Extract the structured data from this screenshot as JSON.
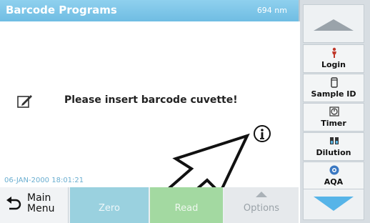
{
  "header": {
    "title": "Barcode Programs",
    "wavelength": "694 nm"
  },
  "main": {
    "message": "Please insert barcode cuvette!",
    "datetime": "06-JAN-2000  18:01:21"
  },
  "bottom": {
    "main_menu_line1": "Main",
    "main_menu_line2": "Menu",
    "zero": "Zero",
    "read": "Read",
    "options": "Options"
  },
  "sidebar": {
    "items": [
      {
        "label": "Login",
        "icon": "login-icon"
      },
      {
        "label": "Sample ID",
        "icon": "sample-id-icon"
      },
      {
        "label": "Timer",
        "icon": "timer-icon"
      },
      {
        "label": "Dilution",
        "icon": "dilution-icon"
      },
      {
        "label": "AQA",
        "icon": "aqa-icon"
      }
    ]
  },
  "colors": {
    "title_bar": "#6fbde3",
    "zero_button": "#9ad1df",
    "read_button": "#a3d9a1",
    "scroll_down_arrow": "#56b4e8"
  }
}
